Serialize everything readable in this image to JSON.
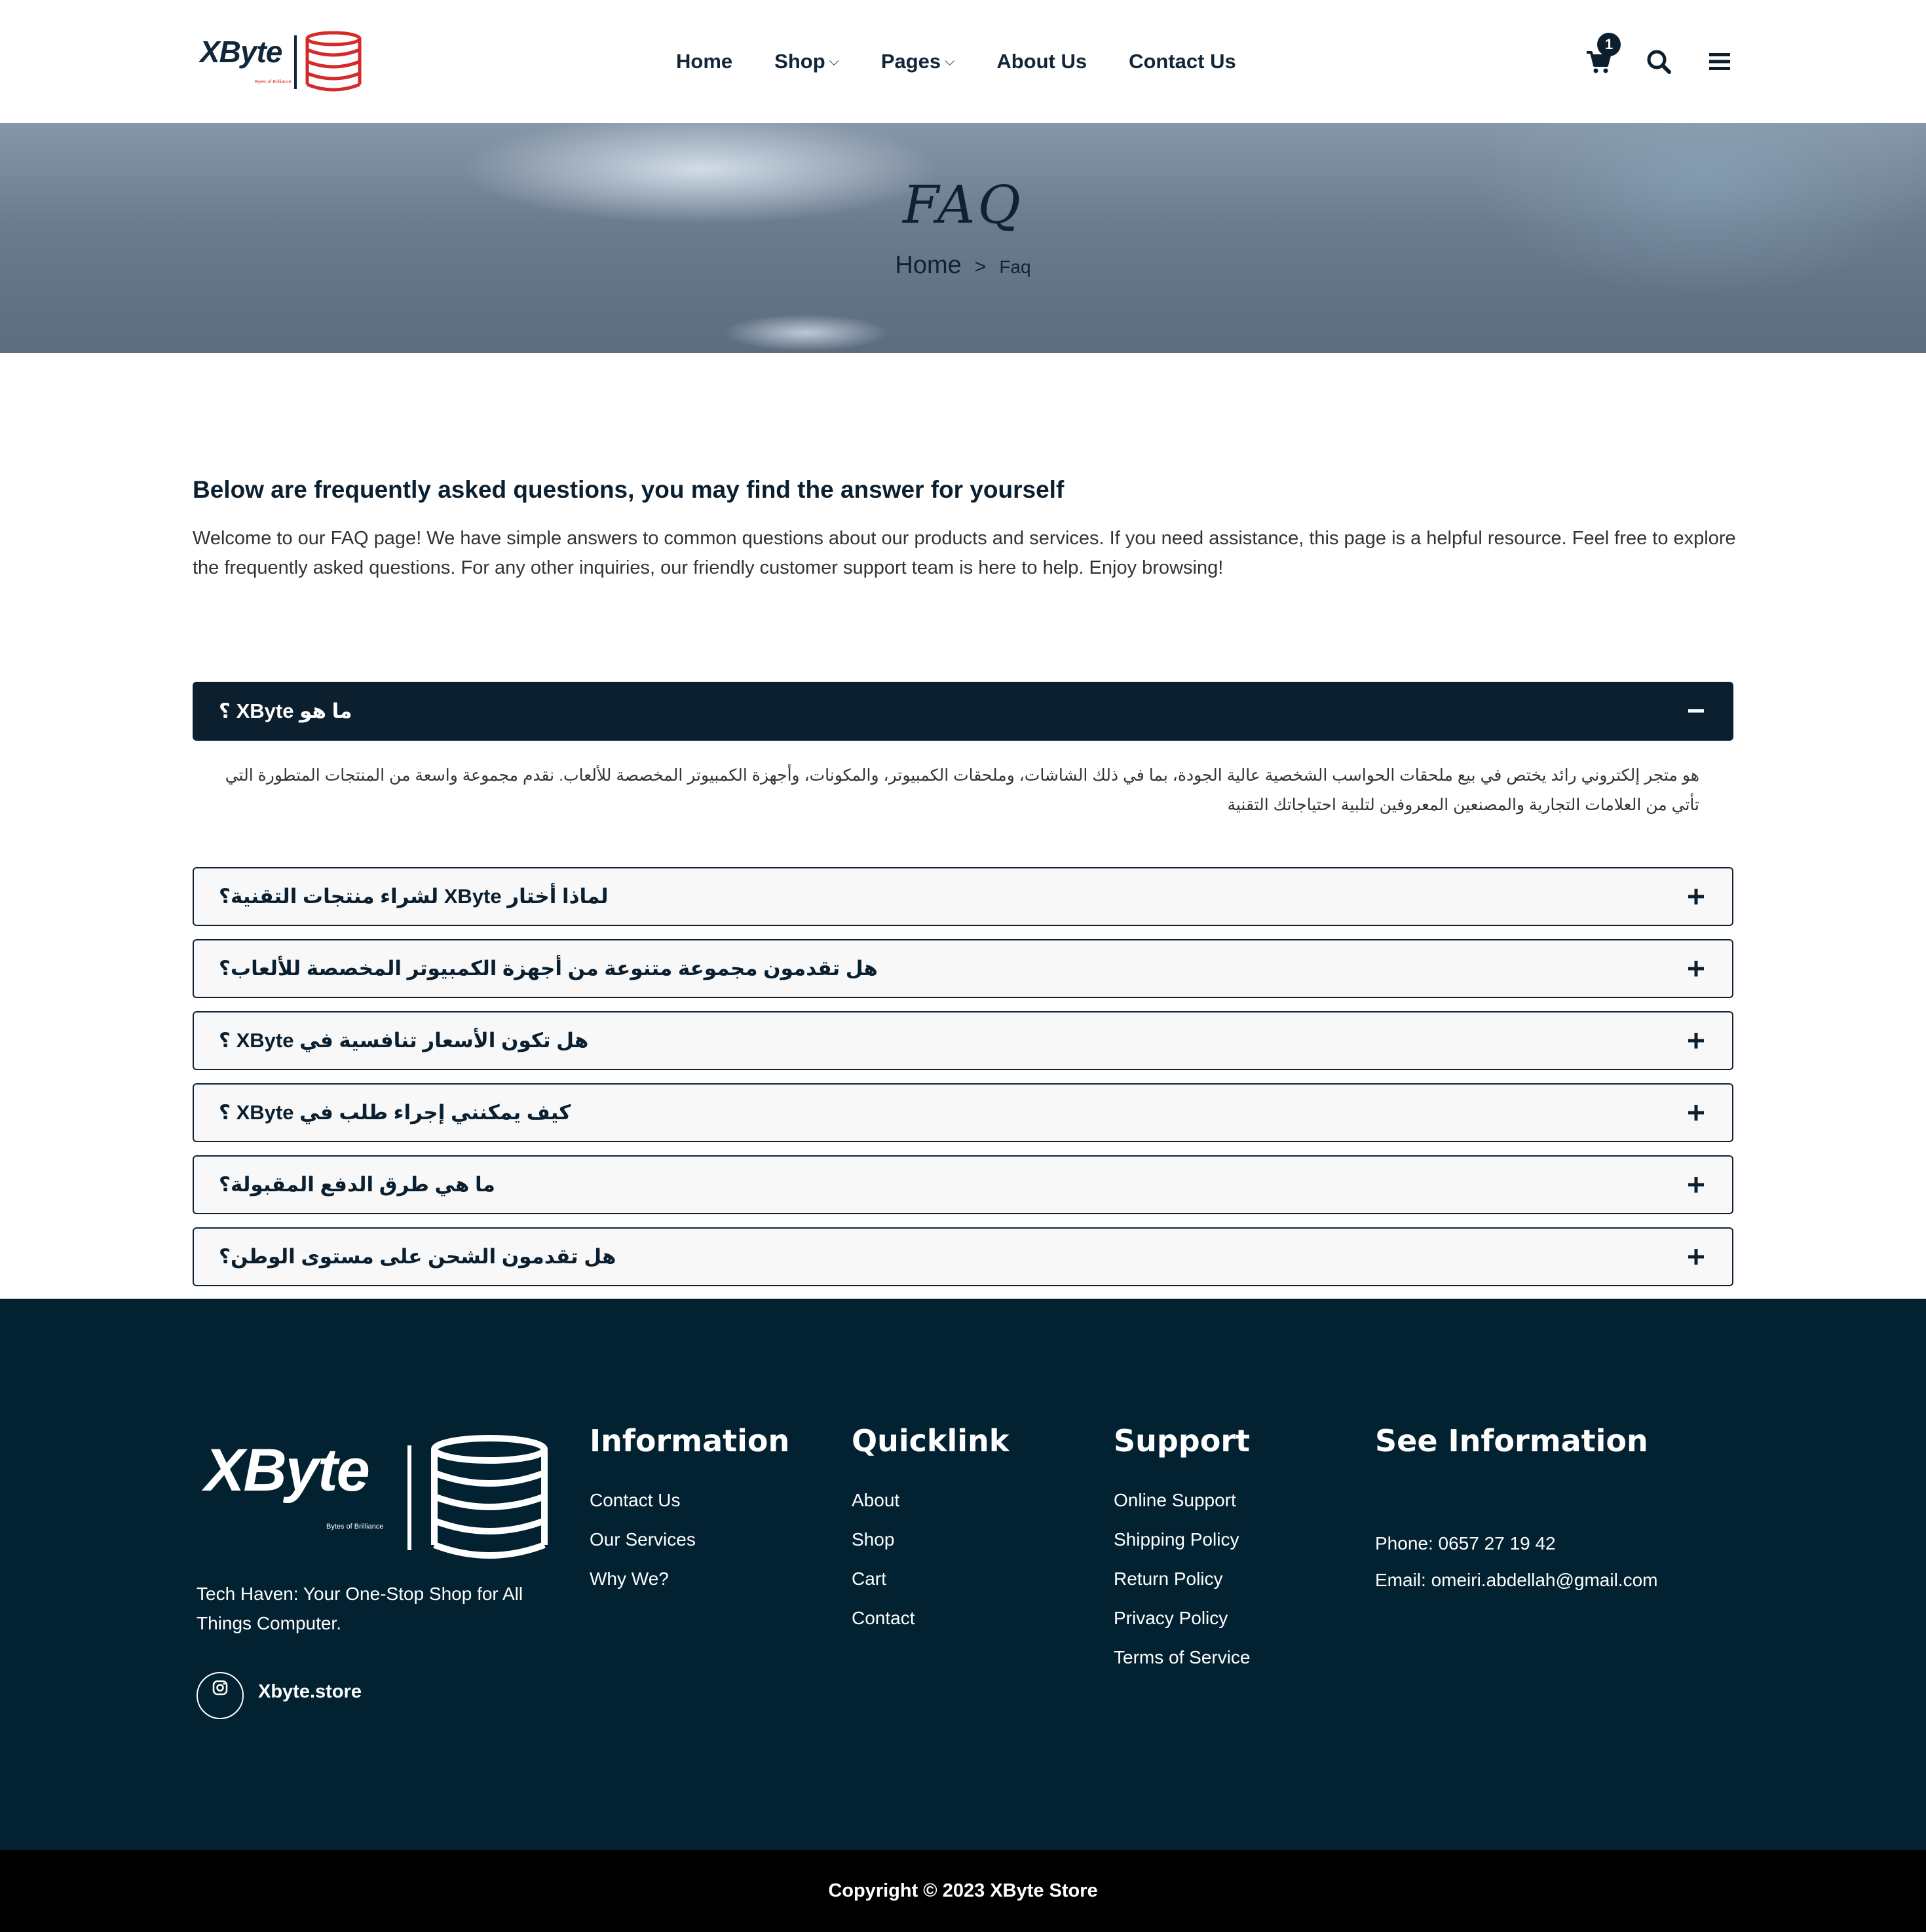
{
  "header": {
    "logo_text": "XByte",
    "logo_tagline": "Bytes of Brilliance",
    "nav": [
      {
        "label": "Home"
      },
      {
        "label": "Shop"
      },
      {
        "label": "Pages"
      },
      {
        "label": "About Us"
      },
      {
        "label": "Contact Us"
      }
    ],
    "cart_count": "1",
    "icons": [
      "cart-icon",
      "search-icon",
      "menu-icon"
    ],
    "accent_color": "#d42a2a"
  },
  "banner": {
    "title": "FAQ",
    "breadcrumb_home": "Home",
    "breadcrumb_separator": ">",
    "breadcrumb_current": "Faq"
  },
  "intro": {
    "title": "Below are frequently asked questions, you may find the answer for yourself",
    "text": "Welcome to our FAQ page! We have simple answers to common questions about our products and services. If you need assistance, this page is a helpful resource. Feel free to explore the frequently asked questions. For any other inquiries, our friendly customer support team is here to help. Enjoy browsing!"
  },
  "faq": {
    "items": [
      {
        "question": "ما هو XByte ؟",
        "expanded": true
      },
      {
        "question": "لماذا أختار XByte لشراء منتجات التقنية؟",
        "expanded": false
      },
      {
        "question": "هل تقدمون مجموعة متنوعة من أجهزة الكمبيوتر المخصصة للألعاب؟",
        "expanded": false
      },
      {
        "question": "هل تكون الأسعار تنافسية في XByte ؟",
        "expanded": false
      },
      {
        "question": "كيف يمكنني إجراء طلب في XByte ؟",
        "expanded": false
      },
      {
        "question": "ما هي طرق الدفع المقبولة؟",
        "expanded": false
      },
      {
        "question": "هل تقدمون الشحن على مستوى الوطن؟",
        "expanded": false
      }
    ],
    "first_answer": "هو متجر إلكتروني رائد يختص في بيع ملحقات الحواسب الشخصية عالية الجودة، بما في ذلك الشاشات، وملحقات الكمبيوتر، والمكونات، وأجهزة الكمبيوتر المخصصة للألعاب. نقدم مجموعة واسعة من المنتجات المتطورة التي تأتي من العلامات التجارية والمصنعين المعروفين لتلبية احتياجاتك التقنية",
    "active_color": "#0b1f2e"
  },
  "footer": {
    "logo_text": "XByte",
    "logo_tagline": "Bytes of Brilliance",
    "tagline": "Tech Haven: Your One-Stop Shop for All Things Computer.",
    "social_label": "Xbyte.store",
    "columns": [
      {
        "title": "Information",
        "links": [
          "Contact Us",
          "Our Services",
          "Why We?"
        ]
      },
      {
        "title": "Quicklink",
        "links": [
          "About",
          "Shop",
          "Cart",
          "Contact"
        ]
      },
      {
        "title": "Support",
        "links": [
          "Online Support",
          "Shipping Policy",
          "Return Policy",
          "Privacy Policy",
          "Terms of Service"
        ]
      }
    ],
    "info_title": "See Information",
    "phone": "Phone: 0657 27 19 42",
    "email": "Email: omeiri.abdellah@gmail.com",
    "background_color": "#022131"
  },
  "copyright": "Copyright © 2023 XByte Store"
}
